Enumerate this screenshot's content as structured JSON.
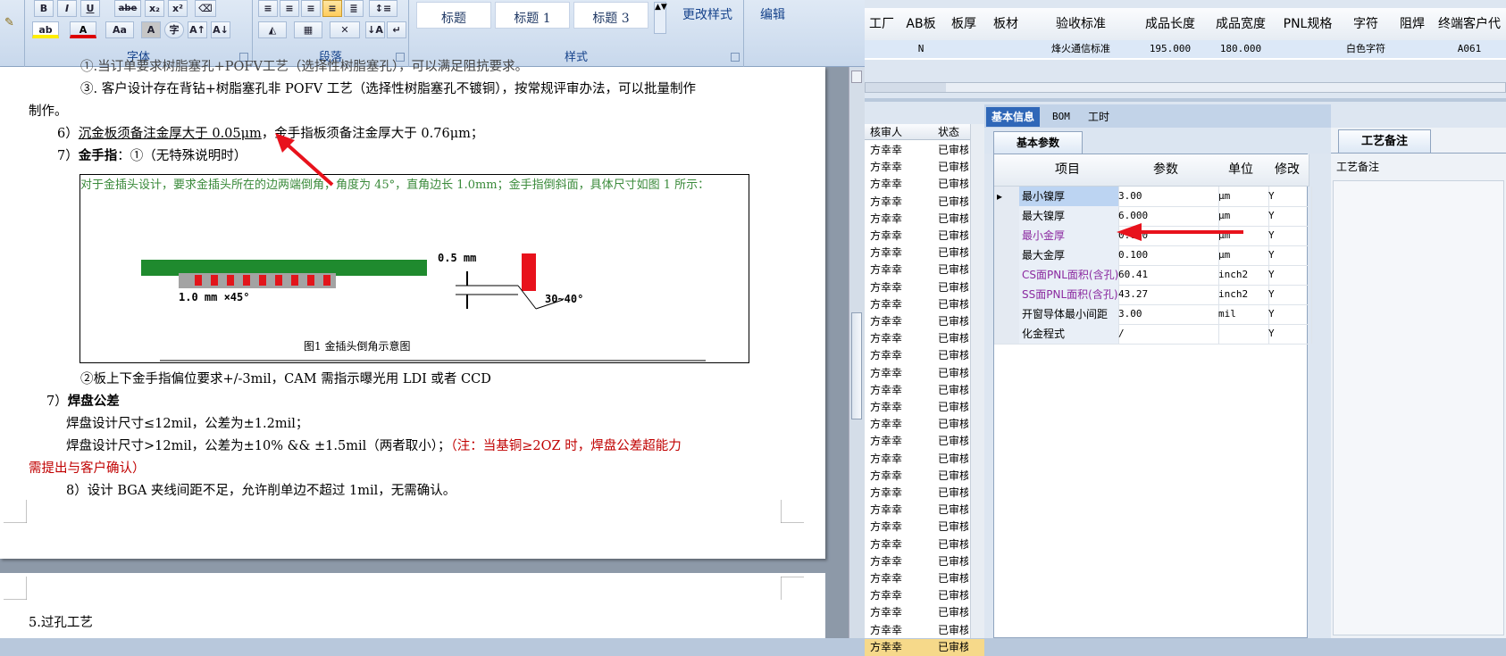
{
  "ribbon": {
    "font_group": "字体",
    "paragraph_group": "段落",
    "styles_group": "样式",
    "font_buttons": [
      "B",
      "I",
      "U",
      "abe",
      "x₂",
      "x²"
    ],
    "font_row2": [
      "ab",
      "A",
      "Aa",
      "A",
      "字",
      "A↑",
      "A↓"
    ],
    "style_items": [
      "标题",
      "标题 1",
      "标题 3"
    ],
    "change_styles": "更改样式",
    "edit": "编辑"
  },
  "doc": {
    "l0": "①.当订单要求树脂塞孔+POFV工艺（选择性树脂塞孔），可以满足阻抗要求。",
    "l1": "③. 客户设计存在背钻+树脂塞孔非 POFV 工艺（选择性树脂塞孔不镀铜），按常规评审办法，可以批量制作",
    "l2": "制作。",
    "l3_pre": "6）",
    "l3_u": "沉金板须备注金厚大于 0.05μm",
    "l3_rest": "，金手指板须备注金厚大于 0.76μm；",
    "l4_num": "7）",
    "l4_title": "金手指",
    "l4_rest": "：①（无特殊说明时）",
    "fig_text": "对于金插头设计，要求金插头所在的边两端倒角，角度为 45°，直角边长 1.0mm；金手指倒斜面，具体尺寸如图 1 所示：",
    "fig_label_05": "0.5 mm",
    "fig_label_10": "1.0 mm ×45°",
    "fig_label_angle": "30~40°",
    "fig_caption": "图1   金插头倒角示意图",
    "l5": "②板上下金手指偏位要求+/-3mil，CAM 需指示曝光用 LDI 或者 CCD",
    "l6_num": "7）",
    "l6_title": "焊盘公差",
    "l7": "焊盘设计尺寸≤12mil，公差为±1.2mil；",
    "l8_black": "焊盘设计尺寸>12mil，公差为±10% && ±1.5mil（两者取小）；",
    "l8_red": "（注：当基铜≥2OZ 时，焊盘公差超能力",
    "l9_red": "需提出与客户确认）",
    "l10": "8）设计 BGA 夹线间距不足，允许削单边不超过 1mil，无需确认。",
    "p2_text": "5.过孔工艺"
  },
  "grid1": {
    "headers": [
      "工厂",
      "AB板",
      "板厚",
      "板材",
      "验收标准",
      "成品长度",
      "成品宽度",
      "PNL规格",
      "字符",
      "阻焊",
      "终端客户代"
    ],
    "row": [
      "",
      "N",
      "",
      "",
      "烽火通信标准",
      "195.000",
      "180.000",
      "",
      "白色字符",
      "",
      "A061"
    ]
  },
  "leftlist": {
    "col1": "核审人",
    "col2": "状态",
    "reviewer": "方幸幸",
    "status": "已审核",
    "row_count": 30
  },
  "tabs": {
    "t1": "基本信息",
    "t2": "BOM",
    "t3": "工时",
    "sub": "基本参数",
    "notes_tab": "工艺备注",
    "notes_label": "工艺备注"
  },
  "params": {
    "headers": [
      "项目",
      "参数",
      "单位",
      "修改"
    ],
    "rows": [
      {
        "item": "最小镍厚",
        "value": "3.00",
        "unit": "μm",
        "mod": "Y"
      },
      {
        "item": "最大镍厚",
        "value": "6.000",
        "unit": "μm",
        "mod": "Y"
      },
      {
        "item": "最小金厚",
        "value": "0.050",
        "unit": "μm",
        "mod": "Y"
      },
      {
        "item": "最大金厚",
        "value": "0.100",
        "unit": "μm",
        "mod": "Y"
      },
      {
        "item": "CS面PNL面积(含孔)",
        "value": "60.41",
        "unit": "inch2",
        "mod": "Y"
      },
      {
        "item": "SS面PNL面积(含孔)",
        "value": "43.27",
        "unit": "inch2",
        "mod": "Y"
      },
      {
        "item": "开窗导体最小间距",
        "value": "3.00",
        "unit": "mil",
        "mod": "Y"
      },
      {
        "item": "化金程式",
        "value": "/",
        "unit": "",
        "mod": "Y"
      }
    ]
  },
  "colors": {
    "accent": "#2f67b8",
    "annotation_red": "#e8121c",
    "purple_text": "#8b2aa0"
  }
}
